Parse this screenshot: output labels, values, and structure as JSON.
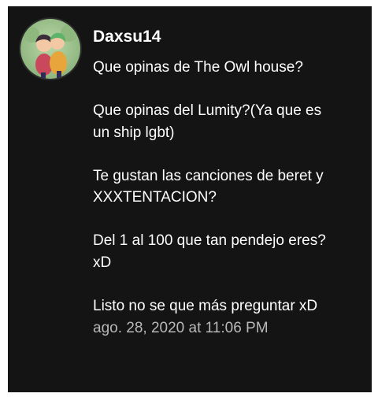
{
  "comment": {
    "username": "Daxsu14",
    "lines": [
      "Que opinas de The Owl house?",
      "",
      "Que opinas del Lumity?(Ya que es",
      "un ship lgbt)",
      "",
      "Te gustan las canciones de beret y",
      "XXXTENTACION?",
      "",
      "Del 1 al 100 que tan pendejo eres?",
      "xD",
      "",
      "Listo no se que más preguntar xD"
    ],
    "timestamp": "ago. 28, 2020 at 11:06 PM"
  },
  "colors": {
    "card_background": "#141414",
    "text": "#ffffff",
    "timestamp": "#b8b8b8"
  },
  "icons": {
    "avatar": "user-avatar-illustration"
  }
}
